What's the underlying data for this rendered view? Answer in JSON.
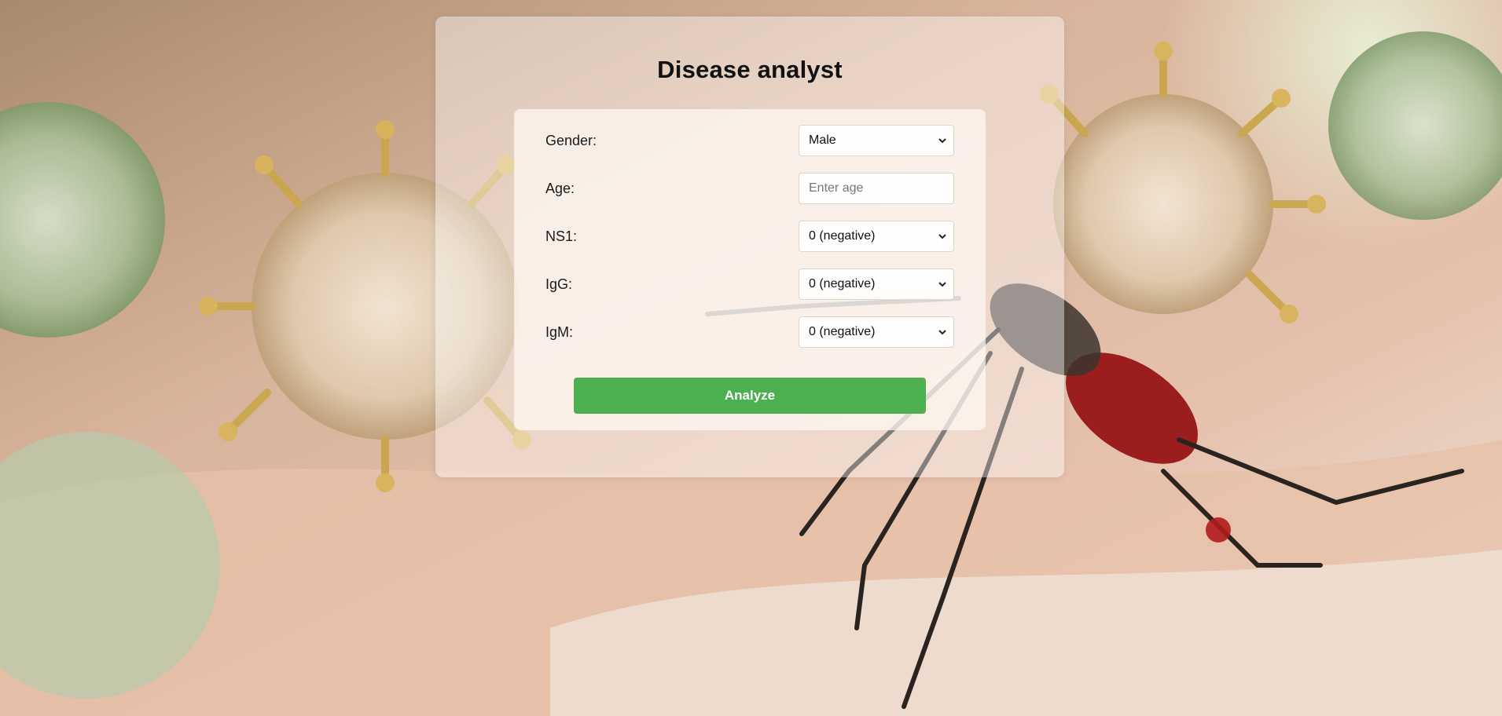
{
  "page": {
    "title": "Disease analyst",
    "background_image": "virus-and-mosquito-photo"
  },
  "form": {
    "fields": [
      {
        "label": "Gender:",
        "type": "select",
        "value": "Male"
      },
      {
        "label": "Age:",
        "type": "input",
        "value": "",
        "placeholder": "Enter age"
      },
      {
        "label": "NS1:",
        "type": "select",
        "value": "0 (negative)"
      },
      {
        "label": "IgG:",
        "type": "select",
        "value": "0 (negative)"
      },
      {
        "label": "IgM:",
        "type": "select",
        "value": "0 (negative)"
      }
    ],
    "submit_label": "Analyze"
  },
  "colors": {
    "accent": "#4caf50",
    "button_text": "#ffffff"
  },
  "icons": {
    "select_arrow": "chevron-down-icon"
  }
}
